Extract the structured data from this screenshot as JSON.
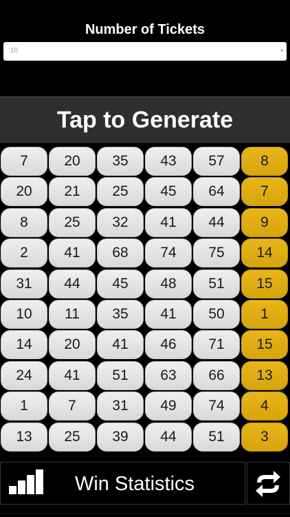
{
  "header": {
    "tickets_label": "Number of Tickets"
  },
  "ticket_select": {
    "value": "10",
    "caret": "▾"
  },
  "generate_button": {
    "label": "Tap to Generate"
  },
  "tickets": [
    {
      "numbers": [
        "7",
        "20",
        "35",
        "43",
        "57"
      ],
      "bonus": "8"
    },
    {
      "numbers": [
        "20",
        "21",
        "25",
        "45",
        "64"
      ],
      "bonus": "7"
    },
    {
      "numbers": [
        "8",
        "25",
        "32",
        "41",
        "44"
      ],
      "bonus": "9"
    },
    {
      "numbers": [
        "2",
        "41",
        "68",
        "74",
        "75"
      ],
      "bonus": "14"
    },
    {
      "numbers": [
        "31",
        "44",
        "45",
        "48",
        "51"
      ],
      "bonus": "15"
    },
    {
      "numbers": [
        "10",
        "11",
        "35",
        "41",
        "50"
      ],
      "bonus": "1"
    },
    {
      "numbers": [
        "14",
        "20",
        "41",
        "46",
        "71"
      ],
      "bonus": "15"
    },
    {
      "numbers": [
        "24",
        "41",
        "51",
        "63",
        "66"
      ],
      "bonus": "13"
    },
    {
      "numbers": [
        "1",
        "7",
        "31",
        "49",
        "74"
      ],
      "bonus": "4"
    },
    {
      "numbers": [
        "13",
        "25",
        "39",
        "44",
        "51"
      ],
      "bonus": "3"
    }
  ],
  "bottom_bar": {
    "stats_label": "Win Statistics",
    "stats_icon": "bar-chart-icon",
    "swap_icon": "swap-arrows-icon"
  },
  "colors": {
    "background": "#000000",
    "bonus_ball": "#e0ae12",
    "regular_ball": "#e4e4e6",
    "generate_bg": "#2e2e2e"
  }
}
